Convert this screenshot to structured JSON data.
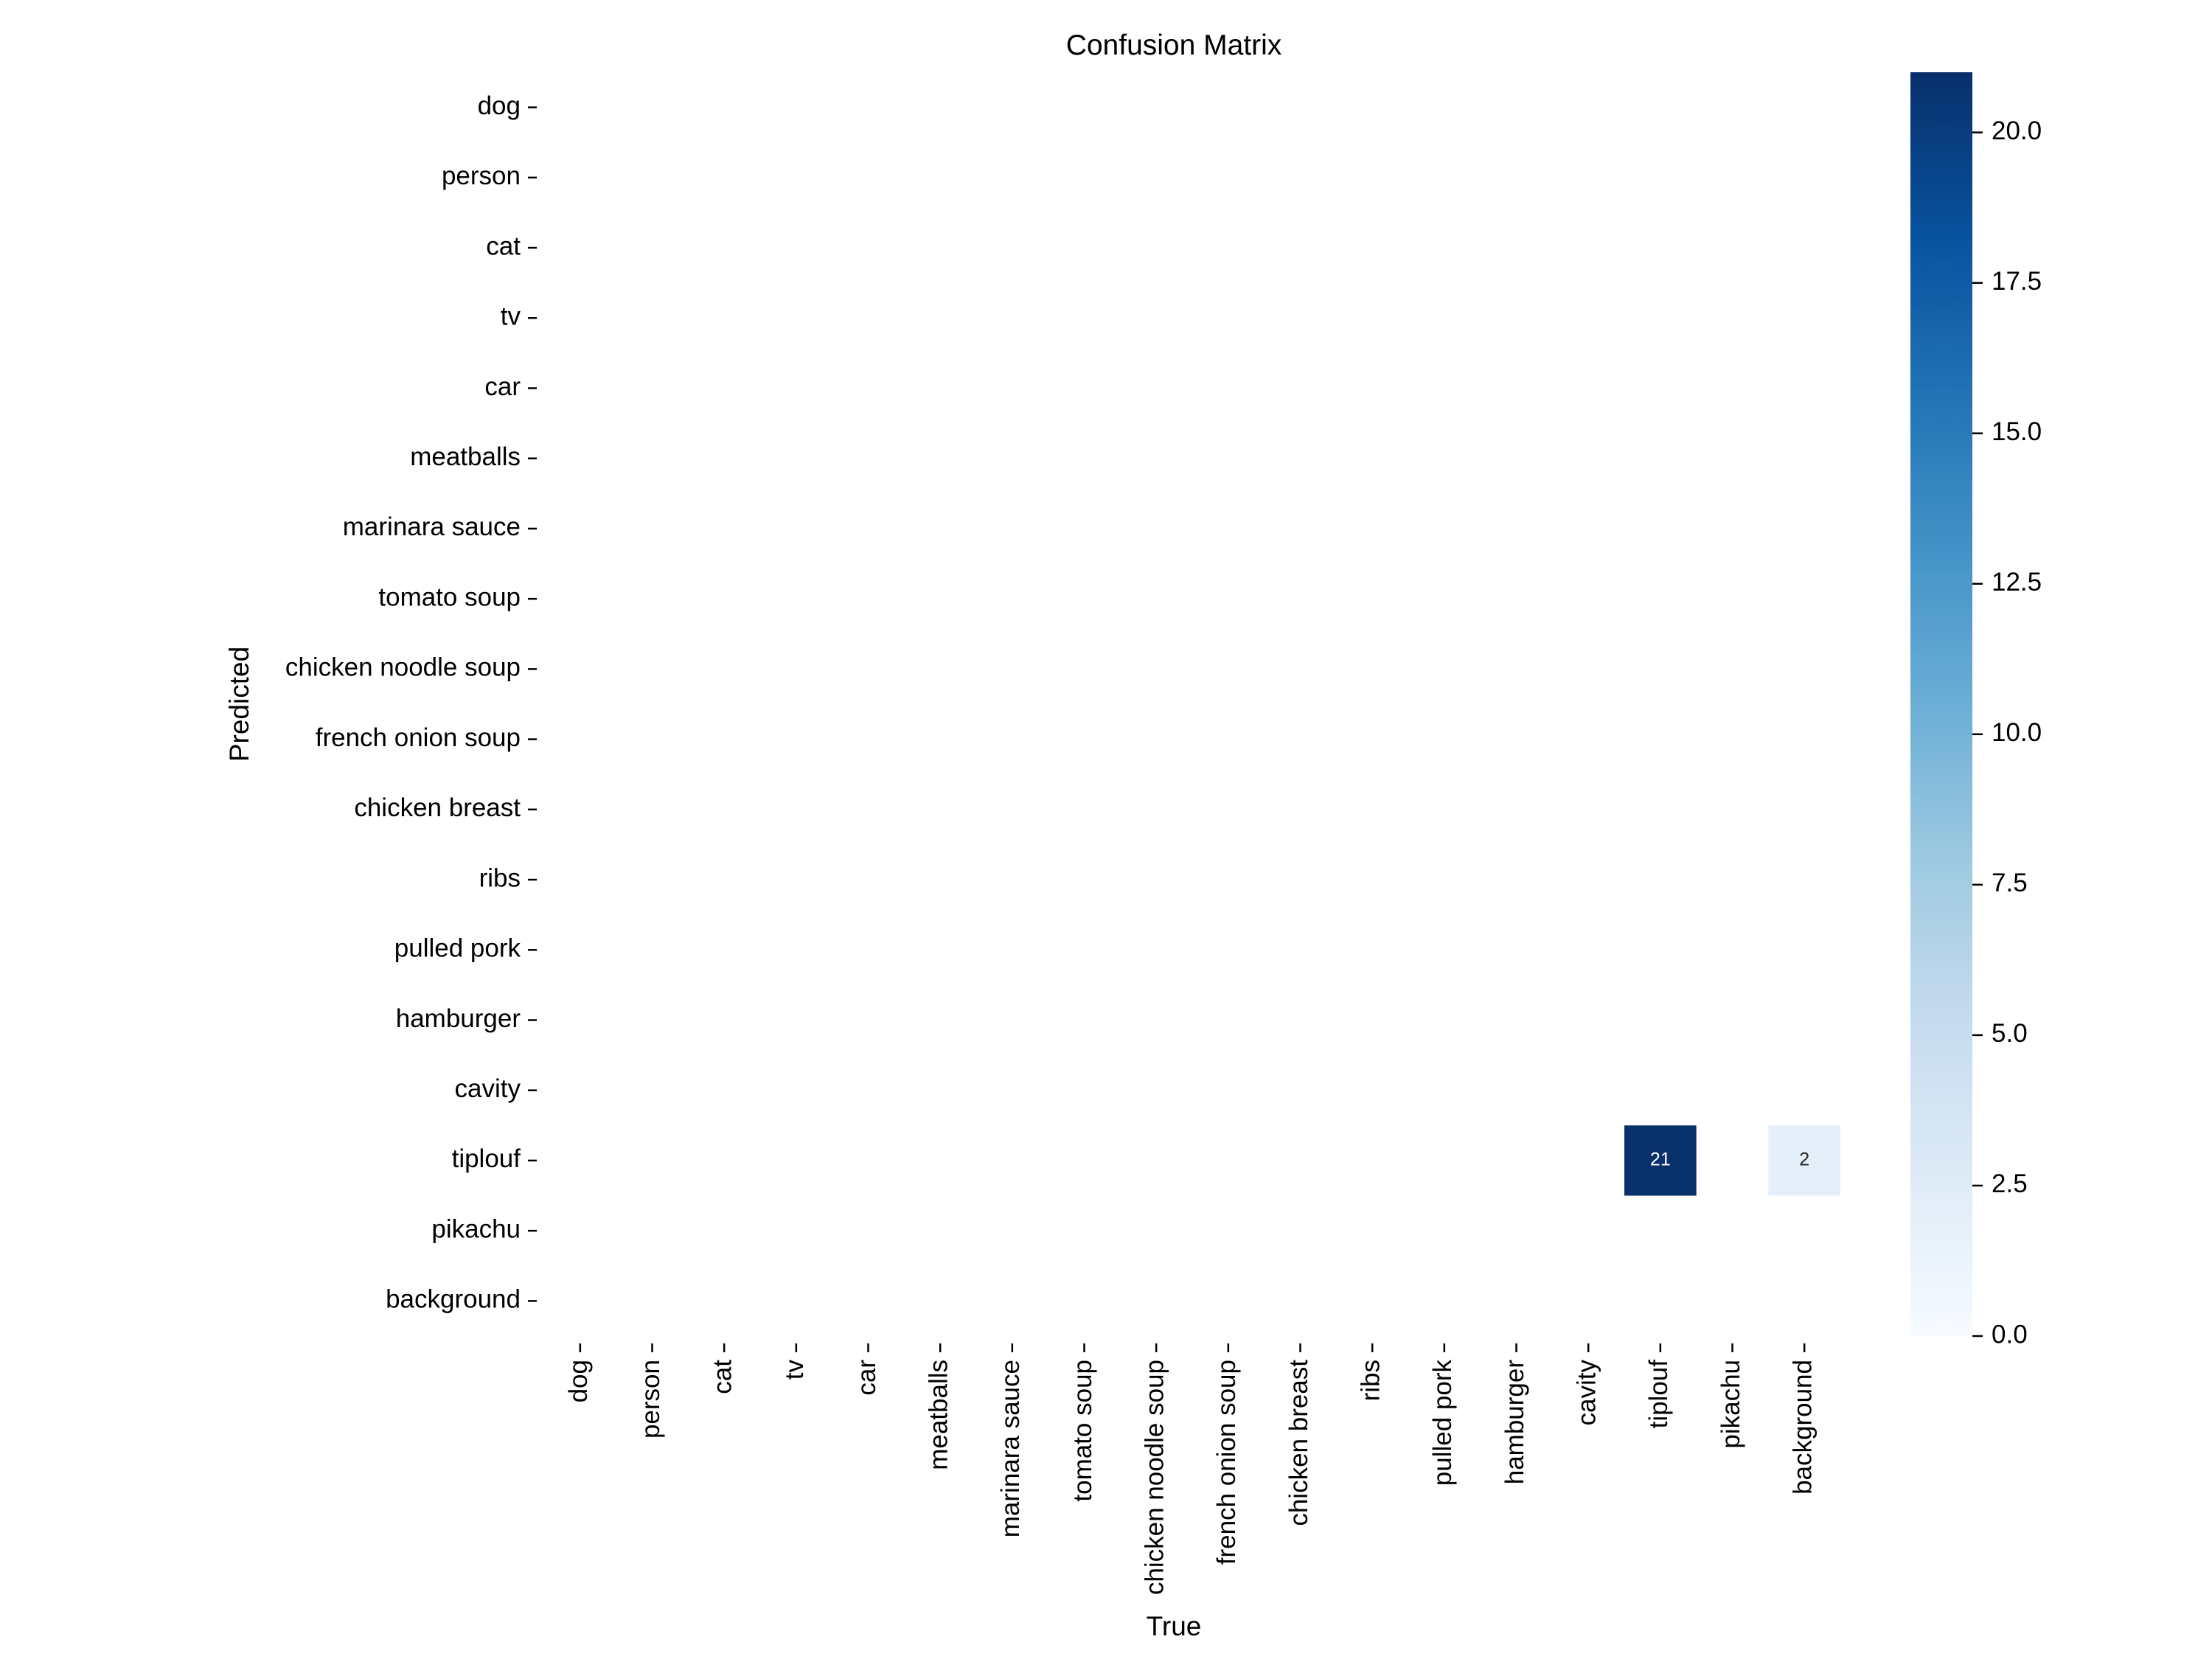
{
  "chart_data": {
    "type": "heatmap",
    "title": "Confusion Matrix",
    "xlabel": "True",
    "ylabel": "Predicted",
    "rows": [
      "dog",
      "person",
      "cat",
      "tv",
      "car",
      "meatballs",
      "marinara sauce",
      "tomato soup",
      "chicken noodle soup",
      "french onion soup",
      "chicken breast",
      "ribs",
      "pulled pork",
      "hamburger",
      "cavity",
      "tiplouf",
      "pikachu",
      "background"
    ],
    "columns": [
      "dog",
      "person",
      "cat",
      "tv",
      "car",
      "meatballs",
      "marinara sauce",
      "tomato soup",
      "chicken noodle soup",
      "french onion soup",
      "chicken breast",
      "ribs",
      "pulled pork",
      "hamburger",
      "cavity",
      "tiplouf",
      "pikachu",
      "background"
    ],
    "cells": [
      {
        "row": "tiplouf",
        "col": "tiplouf",
        "value": 21
      },
      {
        "row": "tiplouf",
        "col": "background",
        "value": 2
      }
    ],
    "zero_cells_shown": false,
    "colormap": "Blues",
    "colorbar": {
      "range": [
        0,
        21
      ],
      "ticks": [
        0.0,
        2.5,
        5.0,
        7.5,
        10.0,
        12.5,
        15.0,
        17.5,
        20.0
      ],
      "tick_labels": [
        "0.0",
        "2.5",
        "5.0",
        "7.5",
        "10.0",
        "12.5",
        "15.0",
        "17.5",
        "20.0"
      ]
    },
    "colors": {
      "low": "#f7fbff",
      "mid": "#6baed6",
      "high": "#08306b"
    }
  }
}
